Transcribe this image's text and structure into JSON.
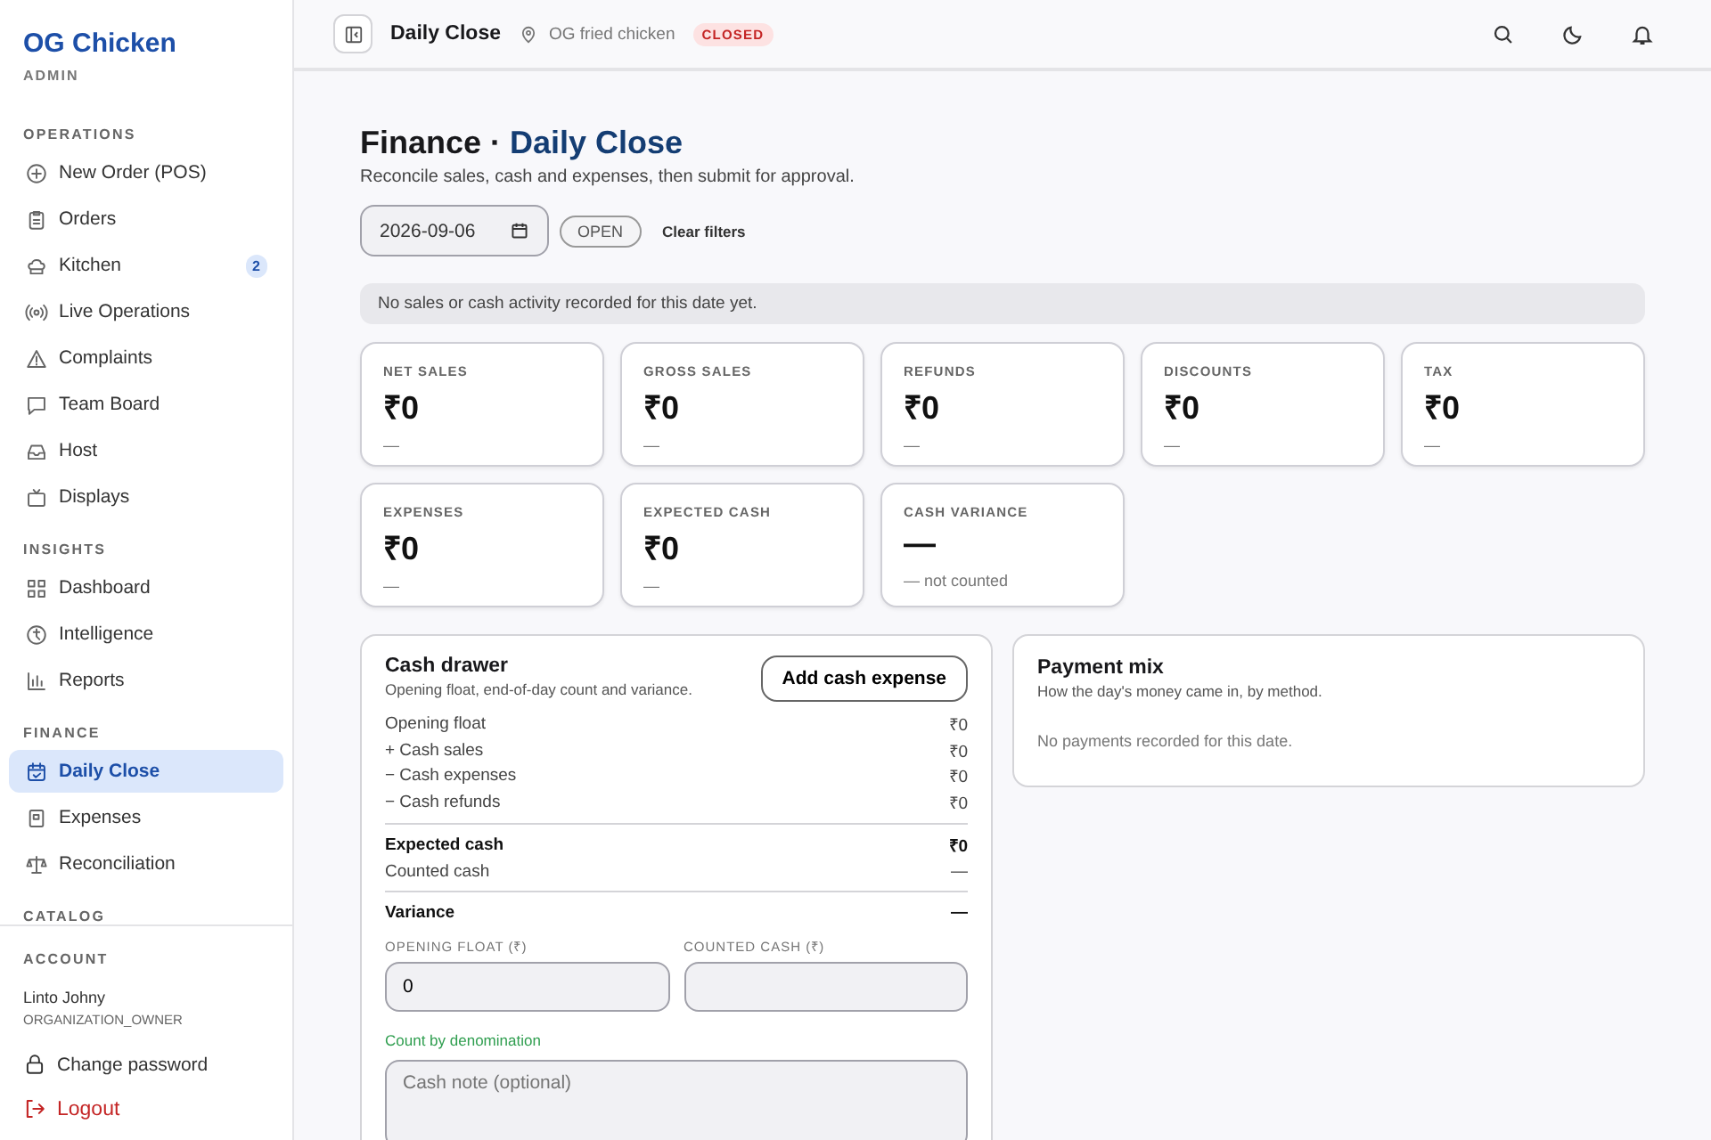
{
  "brand": {
    "name": "OG Chicken",
    "role": "ADMIN"
  },
  "sidebar": {
    "sections": [
      {
        "title": "OPERATIONS",
        "items": [
          {
            "label": "New Order (POS)",
            "selected": false
          },
          {
            "label": "Orders",
            "selected": false
          },
          {
            "label": "Kitchen",
            "selected": false,
            "badge": "2"
          },
          {
            "label": "Live Operations",
            "selected": false
          },
          {
            "label": "Complaints",
            "selected": false
          },
          {
            "label": "Team Board",
            "selected": false
          },
          {
            "label": "Host",
            "selected": false
          },
          {
            "label": "Displays",
            "selected": false
          }
        ]
      },
      {
        "title": "INSIGHTS",
        "items": [
          {
            "label": "Dashboard",
            "selected": false
          },
          {
            "label": "Intelligence",
            "selected": false
          },
          {
            "label": "Reports",
            "selected": false
          }
        ]
      },
      {
        "title": "FINANCE",
        "items": [
          {
            "label": "Daily Close",
            "selected": true
          },
          {
            "label": "Expenses",
            "selected": false
          },
          {
            "label": "Reconciliation",
            "selected": false
          }
        ]
      },
      {
        "title": "CATALOG"
      }
    ]
  },
  "account": {
    "title": "ACCOUNT",
    "user": "Linto Johny",
    "role": "ORGANIZATION_OWNER",
    "actions": [
      {
        "label": "Change password",
        "kind": "normal"
      },
      {
        "label": "Logout",
        "kind": "danger"
      }
    ]
  },
  "topbar": {
    "title": "Daily Close",
    "location": "OG fried chicken",
    "status": "CLOSED"
  },
  "page": {
    "crumb": "Finance ·",
    "title": "Daily Close",
    "subtitle": "Reconcile sales, cash and expenses, then submit for approval."
  },
  "filters": {
    "date": "2026-09-06",
    "status": "OPEN",
    "clear": "Clear filters"
  },
  "notice": "No sales or cash activity recorded for this date yet.",
  "metrics": [
    {
      "label": "NET SALES",
      "value": "₹0",
      "sub": "—"
    },
    {
      "label": "GROSS SALES",
      "value": "₹0",
      "sub": "—"
    },
    {
      "label": "REFUNDS",
      "value": "₹0",
      "sub": "—"
    },
    {
      "label": "DISCOUNTS",
      "value": "₹0",
      "sub": "—"
    },
    {
      "label": "TAX",
      "value": "₹0",
      "sub": "—"
    },
    {
      "label": "EXPENSES",
      "value": "₹0",
      "sub": "—"
    },
    {
      "label": "EXPECTED CASH",
      "value": "₹0",
      "sub": "—"
    },
    {
      "label": "CASH VARIANCE",
      "value": "—",
      "sub": "— not counted"
    }
  ],
  "cash_drawer": {
    "title": "Cash drawer",
    "subtitle": "Opening float, end-of-day count and variance.",
    "button": "Add cash expense",
    "lines": [
      {
        "kind": "plain",
        "label": "Opening float",
        "value": "₹0"
      },
      {
        "kind": "plain",
        "label": "+ Cash sales",
        "value": "₹0"
      },
      {
        "kind": "plain",
        "label": "− Cash expenses",
        "value": "₹0"
      },
      {
        "kind": "plain",
        "label": "− Cash refunds",
        "value": "₹0"
      },
      {
        "kind": "total",
        "label": "Expected cash",
        "value": "₹0"
      },
      {
        "kind": "plain",
        "label": "Counted cash",
        "value": "—"
      },
      {
        "kind": "total",
        "label": "Variance",
        "value": "—"
      }
    ],
    "fields": [
      {
        "label": "OPENING FLOAT (₹)",
        "value": "0"
      },
      {
        "label": "COUNTED CASH (₹)"
      }
    ],
    "denomination_link": "Count by denomination",
    "note_placeholder": "Cash note (optional)"
  },
  "payment_mix": {
    "title": "Payment mix",
    "subtitle": "How the day's money came in, by method.",
    "empty": "No payments recorded for this date."
  }
}
